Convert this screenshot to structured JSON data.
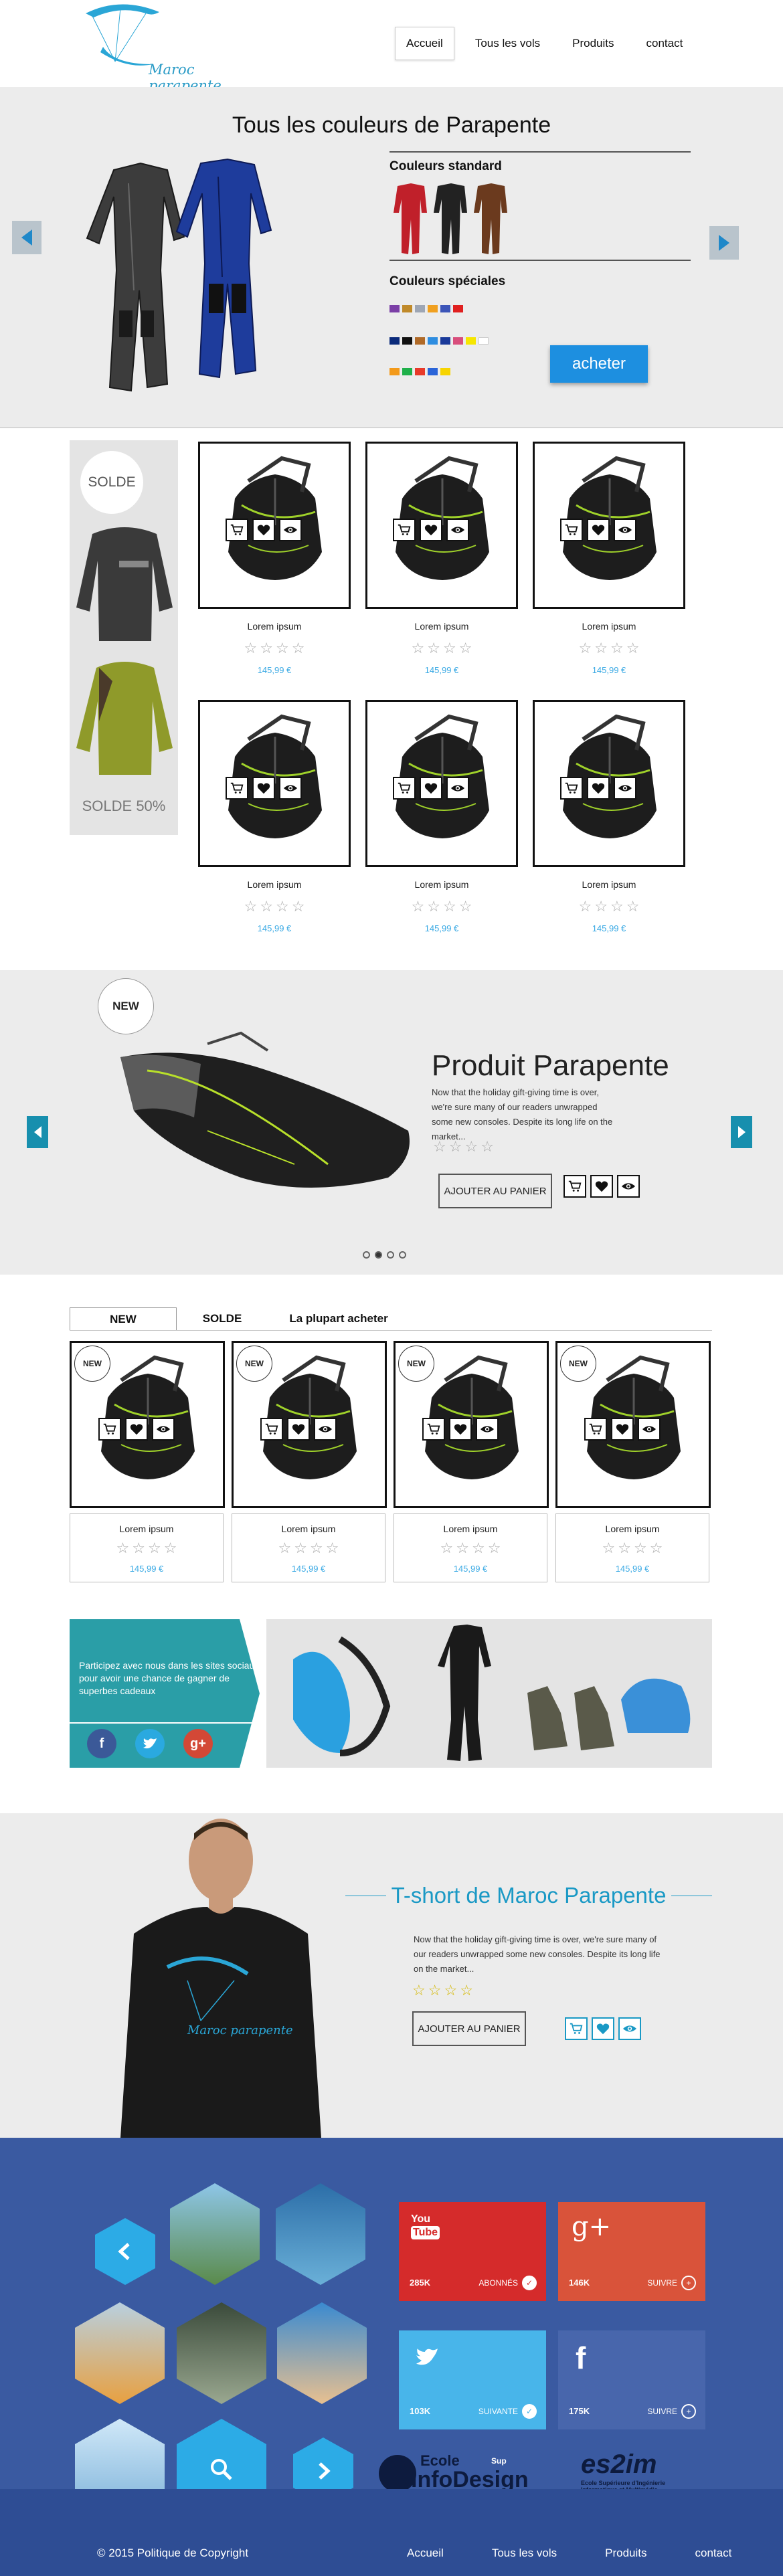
{
  "header": {
    "logo_text": "Maroc parapente",
    "nav": [
      "Accueil",
      "Tous les vols",
      "Produits",
      "contact"
    ]
  },
  "hero": {
    "title": "Tous les couleurs de Parapente",
    "standard_label": "Couleurs standard",
    "special_label": "Couleurs spéciales",
    "buy_label": "acheter",
    "swatches_row1": [
      "#7b3fa6",
      "#c08a2a",
      "#9ea6b4",
      "#f0a020",
      "#3c55b8",
      "#e02020"
    ],
    "swatches_row2": [
      "#0a2a7a",
      "#111111",
      "#b06a28",
      "#2e8de0",
      "#1a3a9a",
      "#d84e7c",
      "#f6e600",
      "#ffffff"
    ],
    "swatches_row3": [
      "#f39a1a",
      "#1fb04a",
      "#e83a2a",
      "#2a64d8",
      "#f7d400"
    ]
  },
  "sale": {
    "badge": "SOLDE",
    "discount": "SOLDE 50%"
  },
  "grid": {
    "products": [
      {
        "name": "Lorem ipsum",
        "price": "145,99 €"
      },
      {
        "name": "Lorem ipsum",
        "price": "145,99 €"
      },
      {
        "name": "Lorem ipsum",
        "price": "145,99 €"
      },
      {
        "name": "Lorem ipsum",
        "price": "145,99 €"
      },
      {
        "name": "Lorem ipsum",
        "price": "145,99 €"
      },
      {
        "name": "Lorem ipsum",
        "price": "145,99 €"
      }
    ]
  },
  "slider": {
    "badge": "NEW",
    "title": "Produit Parapente",
    "text": "Now that the holiday gift-giving time is over, we're sure many of our readers unwrapped some new consoles. Despite its long life on the market...",
    "cart_label": "AJOUTER AU PANIER",
    "rating": 0
  },
  "tabs": {
    "items": [
      "NEW",
      "SOLDE",
      "La plupart acheter"
    ],
    "badge": "NEW",
    "products": [
      {
        "name": "Lorem ipsum",
        "price": "145,99 €"
      },
      {
        "name": "Lorem ipsum",
        "price": "145,99 €"
      },
      {
        "name": "Lorem ipsum",
        "price": "145,99 €"
      },
      {
        "name": "Lorem ipsum",
        "price": "145,99 €"
      }
    ]
  },
  "banner": {
    "text": "Participez avec nous dans les sites sociaux pour avoir une chance de gagner de superbes cadeaux"
  },
  "tshirt": {
    "title": "T-short de Maroc Parapente",
    "print": "Maroc parapente",
    "text": "Now that the holiday gift-giving time is over, we're sure many of our readers unwrapped some new consoles. Despite its long life on the market...",
    "cart_label": "AJOUTER AU PANIER",
    "rating": 4
  },
  "social": {
    "youtube": {
      "count": "285K",
      "action": "ABONNÉS",
      "logo_top": "You",
      "logo_bottom": "Tube"
    },
    "gplus": {
      "count": "146K",
      "action": "SUIVRE",
      "logo": "g+"
    },
    "twitter": {
      "count": "103K",
      "action": "SUIVANTE"
    },
    "facebook": {
      "count": "175K",
      "action": "SUIVRE",
      "logo": "f"
    }
  },
  "schools": {
    "infodesign_top": "Ecole",
    "infodesign_sup": "Sup",
    "infodesign_main": "InfoDesign",
    "eszim": "es2im",
    "eszim_sub1": "Ecole Supérieure d'Ingénierie",
    "eszim_sub2": "Informatique et Multimédia"
  },
  "footer": {
    "copyright": "© 2015 Politique de Copyright",
    "nav": [
      "Accueil",
      "Tous les vols",
      "Produits",
      "contact"
    ]
  }
}
